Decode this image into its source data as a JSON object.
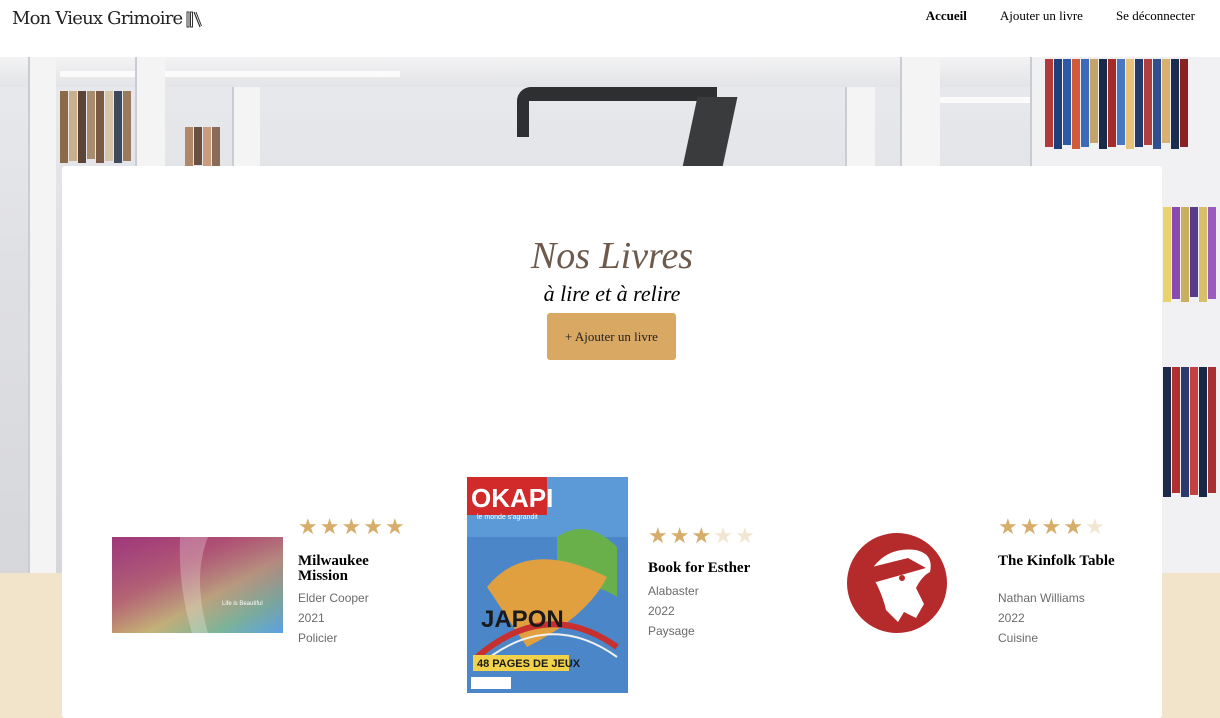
{
  "header": {
    "logo": "Mon Vieux Grimoire",
    "nav": [
      {
        "label": "Accueil",
        "active": true
      },
      {
        "label": "Ajouter un livre",
        "active": false
      },
      {
        "label": "Se déconnecter",
        "active": false
      }
    ]
  },
  "main": {
    "title": "Nos Livres",
    "subtitle": "à lire et à relire",
    "add_button": "+ Ajouter un livre"
  },
  "books": [
    {
      "title": "Milwaukee Mission",
      "author": "Elder Cooper",
      "year": "2021",
      "genre": "Policier",
      "rating": 5,
      "cover_text": "Life is Beautiful"
    },
    {
      "title": "Book for Esther",
      "author": "Alabaster",
      "year": "2022",
      "genre": "Paysage",
      "rating": 3,
      "cover_text": "OKAPI",
      "cover_sub": "le monde s'agrandit",
      "cover_label1": "JAPON",
      "cover_label2": "48 PAGES DE JEUX"
    },
    {
      "title": "The Kinfolk Table",
      "author": "Nathan Williams",
      "year": "2022",
      "genre": "Cuisine",
      "rating": 4
    }
  ],
  "colors": {
    "accent": "#d9a862",
    "star_on": "#d7ad6c",
    "star_off": "#f2e6d3",
    "beige": "#f2e3cb",
    "title": "#6e5a4c"
  },
  "icons": {
    "logo": "book-spines-icon",
    "star": "star-icon"
  }
}
